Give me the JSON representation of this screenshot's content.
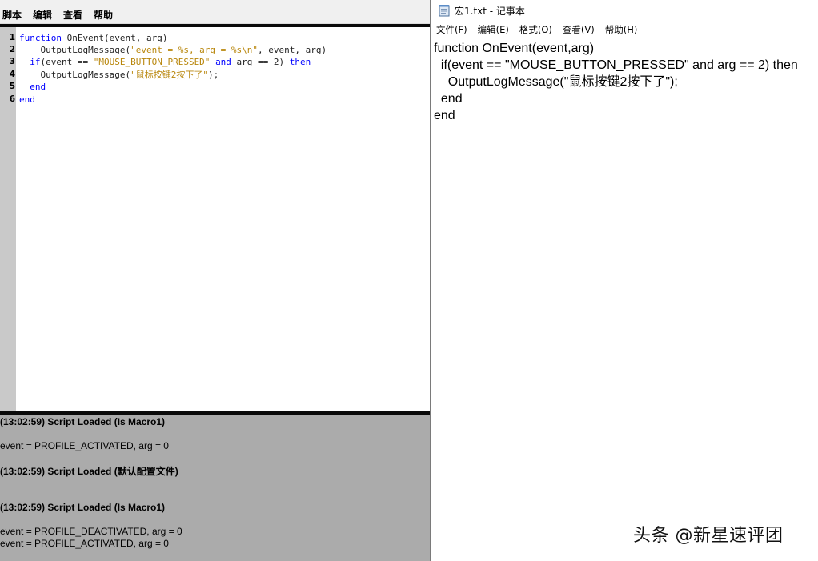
{
  "editor": {
    "menu": [
      "脚本",
      "编辑",
      "查看",
      "帮助"
    ],
    "line_numbers": [
      "1",
      "2",
      "3",
      "4",
      "5",
      "6"
    ],
    "code": {
      "l1_kw": "function",
      "l1_rest": " OnEvent(event, arg)",
      "l2_indent": "    ",
      "l2_fn": "OutputLogMessage(",
      "l2_str": "\"event = %s, arg = %s\\n\"",
      "l2_rest": ", event, arg)",
      "l3_indent": "  ",
      "l3_kw": "if",
      "l3_a": "(event == ",
      "l3_str": "\"MOUSE_BUTTON_PRESSED\"",
      "l3_sp": " ",
      "l3_and": "and",
      "l3_b": " arg == 2) ",
      "l3_then": "then",
      "l4_indent": "    ",
      "l4_fn": "OutputLogMessage(",
      "l4_str": "\"鼠标按键2按下了\"",
      "l4_rest": ");",
      "l5_indent": "  ",
      "l5_kw": "end",
      "l6_kw": "end"
    },
    "output": [
      "(13:02:59) Script Loaded (Is Macro1)",
      "event = PROFILE_ACTIVATED, arg = 0",
      "(13:02:59) Script Loaded (默认配置文件)",
      "(13:02:59) Script Loaded (Is Macro1)",
      "event = PROFILE_DEACTIVATED, arg = 0",
      "event = PROFILE_ACTIVATED, arg = 0"
    ]
  },
  "notepad": {
    "title": "宏1.txt - 记事本",
    "icon": "notepad-icon",
    "menu": [
      "文件(F)",
      "编辑(E)",
      "格式(O)",
      "查看(V)",
      "帮助(H)"
    ],
    "lines": [
      "function OnEvent(event,arg)",
      "  if(event == \"MOUSE_BUTTON_PRESSED\" and arg == 2) then",
      "    OutputLogMessage(\"鼠标按键2按下了\");",
      "  end",
      "end"
    ]
  },
  "watermark": "头条 @新星速评团"
}
